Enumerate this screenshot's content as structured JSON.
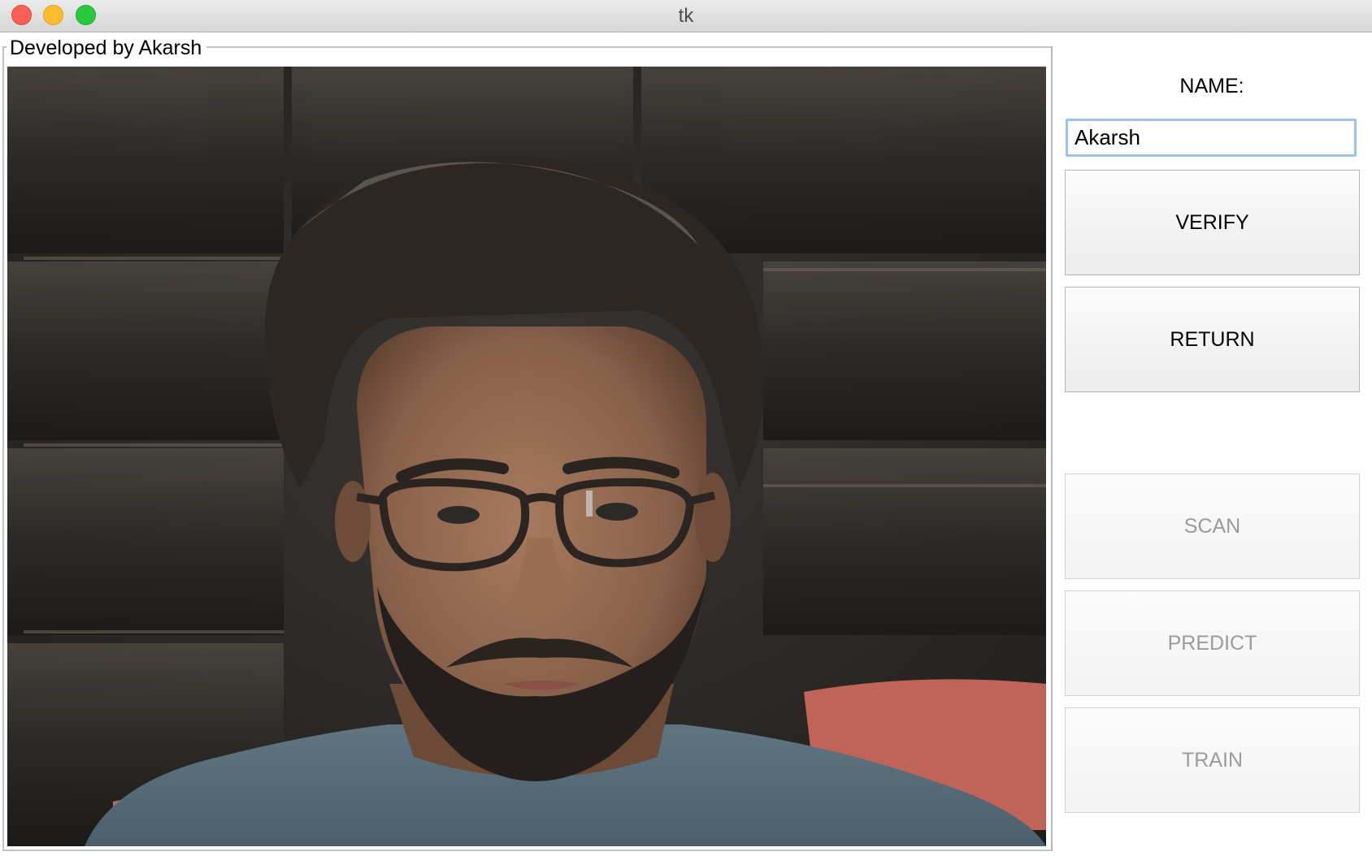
{
  "window": {
    "title": "tk"
  },
  "frame": {
    "legend": "Developed by Akarsh"
  },
  "panel": {
    "name_label": "NAME:",
    "name_value": "Akarsh"
  },
  "buttons": {
    "verify": "VERIFY",
    "return": "RETURN",
    "scan": "SCAN",
    "predict": "PREDICT",
    "train": "TRAIN"
  },
  "button_states": {
    "verify": "enabled",
    "return": "enabled",
    "scan": "disabled",
    "predict": "disabled",
    "train": "disabled"
  },
  "colors": {
    "input_focus_border": "#9ec2ea",
    "disabled_text": "#9b9b9b"
  }
}
